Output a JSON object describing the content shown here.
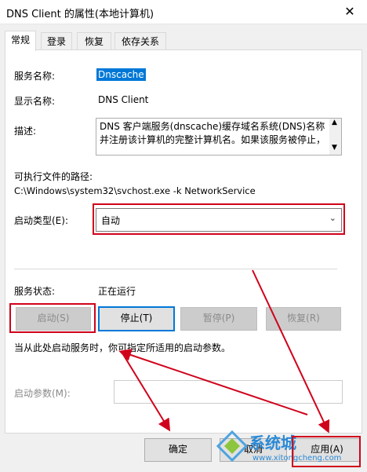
{
  "window": {
    "title": "DNS Client 的属性(本地计算机)"
  },
  "tabs": [
    {
      "label": "常规",
      "active": true
    },
    {
      "label": "登录",
      "active": false
    },
    {
      "label": "恢复",
      "active": false
    },
    {
      "label": "依存关系",
      "active": false
    }
  ],
  "general": {
    "service_name_label": "服务名称:",
    "service_name_value": "Dnscache",
    "display_name_label": "显示名称:",
    "display_name_value": "DNS Client",
    "description_label": "描述:",
    "description_text": "DNS 客户端服务(dnscache)缓存域名系统(DNS)名称并注册该计算机的完整计算机名。如果该服务被停止，",
    "exe_path_label": "可执行文件的路径:",
    "exe_path_value": "C:\\Windows\\system32\\svchost.exe -k NetworkService",
    "startup_type_label": "启动类型(E):",
    "startup_type_value": "自动",
    "status_label": "服务状态:",
    "status_value": "正在运行",
    "buttons": {
      "start": "启动(S)",
      "stop": "停止(T)",
      "pause": "暂停(P)",
      "resume": "恢复(R)"
    },
    "hint": "当从此处启动服务时，你可指定所适用的启动参数。",
    "params_label": "启动参数(M):",
    "params_value": ""
  },
  "footer": {
    "ok": "确定",
    "cancel": "取消",
    "apply": "应用(A)"
  },
  "watermark": {
    "text": "系统城",
    "url": "www.xitongcheng.com"
  },
  "colors": {
    "annotation_red": "#d0021b",
    "selection_blue": "#0078d7"
  }
}
